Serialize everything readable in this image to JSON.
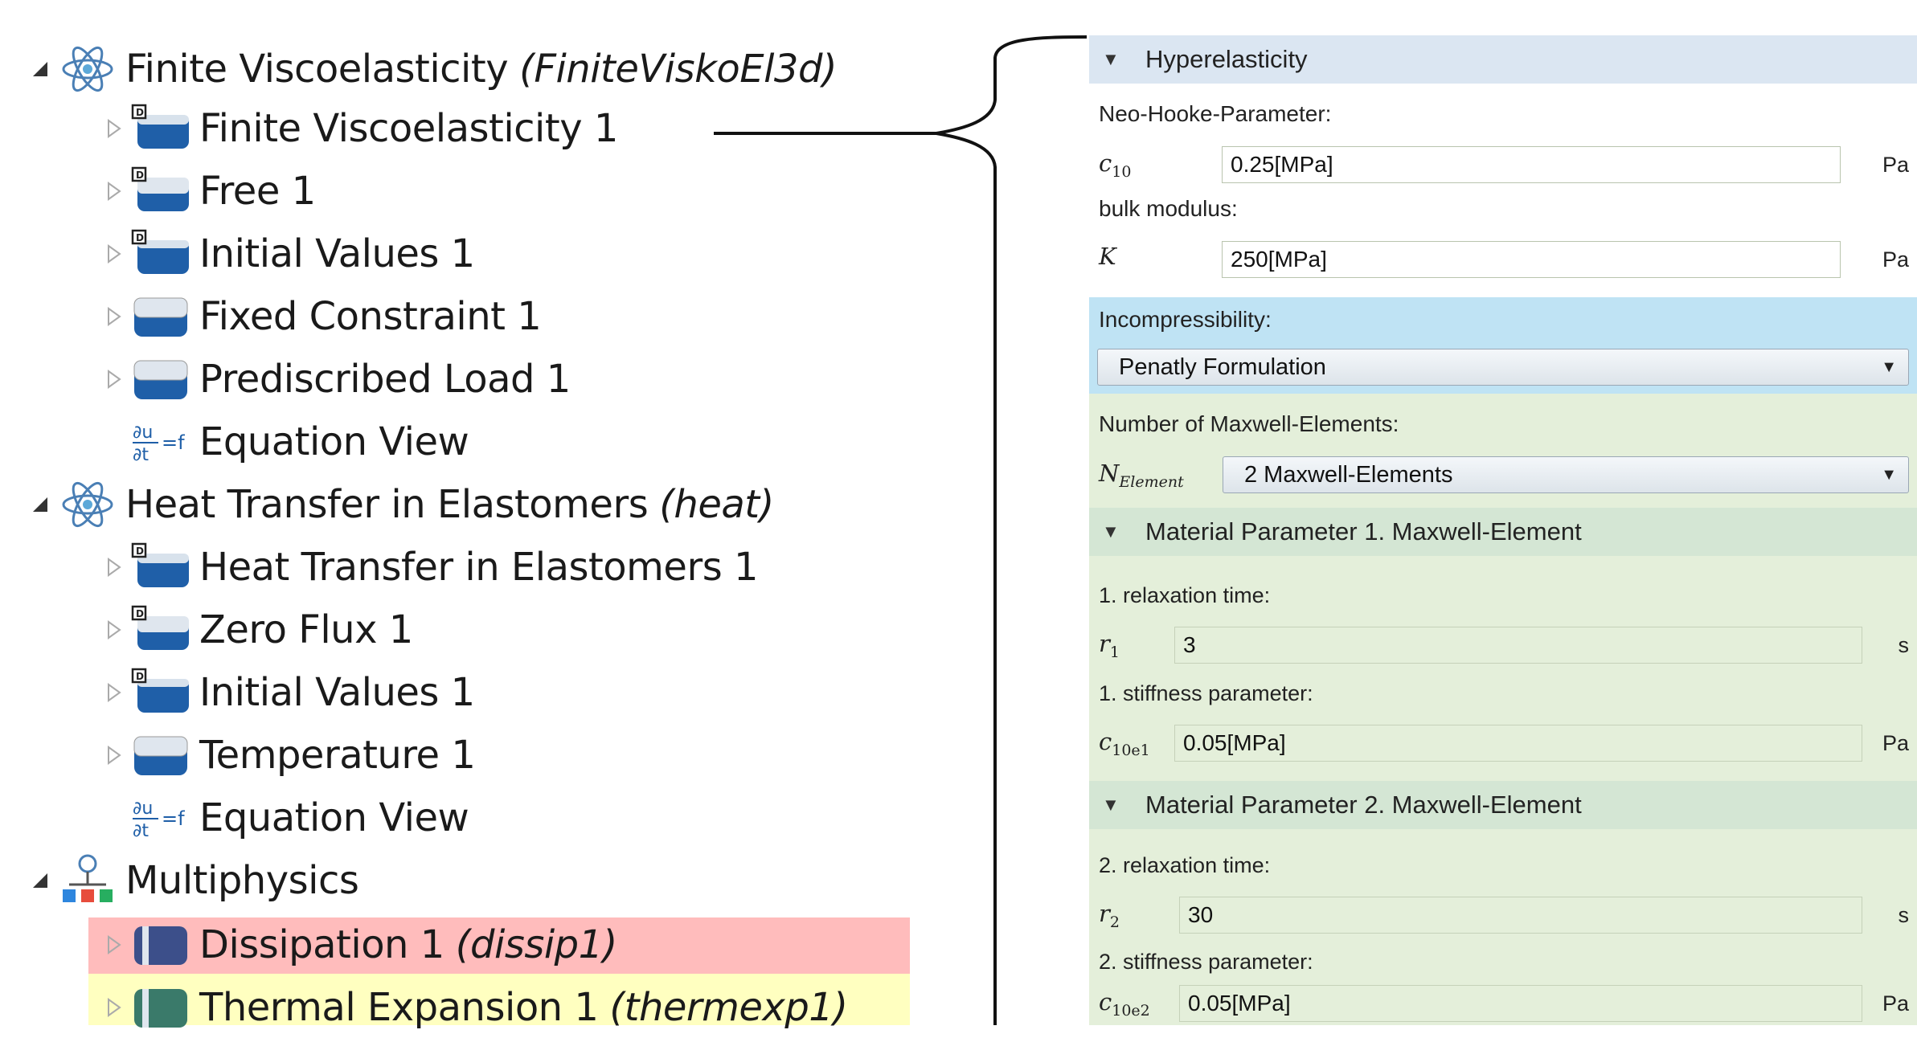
{
  "tree": {
    "physics1": {
      "label": "Finite Viscoelasticity",
      "tag": "(FiniteViskoEl3d)",
      "children": [
        "Finite Viscoelasticity 1",
        "Free 1",
        "Initial Values 1",
        "Fixed Constraint 1",
        "Prediscribed Load 1",
        "Equation View"
      ]
    },
    "physics2": {
      "label": "Heat Transfer in Elastomers",
      "tag": "(heat)",
      "children": [
        "Heat Transfer in Elastomers 1",
        "Zero Flux 1",
        "Initial Values 1",
        "Temperature 1",
        "Equation View"
      ]
    },
    "multiphysics": {
      "label": "Multiphysics",
      "children": [
        {
          "label": "Dissipation 1",
          "tag": "(dissip1)"
        },
        {
          "label": "Thermal Expansion 1",
          "tag": "(thermexp1)"
        }
      ]
    }
  },
  "panel": {
    "hyper": {
      "title": "Hyperelasticity",
      "neo_label": "Neo-Hooke-Parameter:",
      "c10_sym": "c",
      "c10_sub": "10",
      "c10_value": "0.25[MPa]",
      "c10_unit": "Pa",
      "bulk_label": "bulk modulus:",
      "k_sym": "K",
      "k_value": "250[MPa]",
      "k_unit": "Pa",
      "incomp_label": "Incompressibility:",
      "incomp_value": "Penatly Formulation",
      "maxwell_label": "Number of Maxwell-Elements:",
      "n_sym": "N",
      "n_sub": "Element",
      "n_value": "2 Maxwell-Elements"
    },
    "mp1": {
      "title": "Material Parameter 1. Maxwell-Element",
      "relax_label": "1. relaxation time:",
      "r_sym": "r",
      "r_sub": "1",
      "r_value": "3",
      "r_unit": "s",
      "stiff_label": "1. stiffness parameter:",
      "c_sym": "c",
      "c_sub": "10e1",
      "c_value": "0.05[MPa]",
      "c_unit": "Pa"
    },
    "mp2": {
      "title": "Material Parameter 2. Maxwell-Element",
      "relax_label": "2. relaxation time:",
      "r_sym": "r",
      "r_sub": "2",
      "r_value": "30",
      "r_unit": "s",
      "stiff_label": "2. stiffness parameter:",
      "c_sym": "c",
      "c_sub": "10e2",
      "c_value": "0.05[MPa]",
      "c_unit": "Pa"
    }
  },
  "colors": {
    "node_blue": "#1f5fa8",
    "dissipation_highlight": "#ffbcbc",
    "thermal_highlight": "#ffffc0",
    "section_head_blue": "#dbe6f2",
    "incompressibility_blue": "#bfe3f4",
    "panel_green": "#e4efda",
    "section_head_green": "#d4e6d4"
  }
}
